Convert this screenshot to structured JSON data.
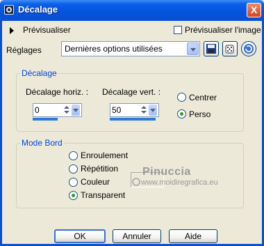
{
  "window": {
    "title": "Décalage",
    "close_glyph": "X"
  },
  "preview": {
    "toggle_label": "Prévisualiser",
    "checkbox_label": "Prévisualiser l'image",
    "checkbox_checked": false
  },
  "settings": {
    "label": "Réglages",
    "preset_value": "Dernières options utilisées"
  },
  "offset_group": {
    "title": "Décalage",
    "horizontal_label": "Décalage horiz. :",
    "horizontal_value": "0",
    "vertical_label": "Décalage vert. :",
    "vertical_value": "50",
    "radio_centered": "Centrer",
    "radio_custom": "Perso",
    "selected": "Perso"
  },
  "edge_group": {
    "title": "Mode Bord",
    "options": [
      "Enroulement",
      "Répétition",
      "Couleur",
      "Transparent"
    ],
    "selected": "Transparent"
  },
  "watermark": {
    "name": "Pinuccia",
    "url": "www.moidiregrafica.eu"
  },
  "buttons": {
    "ok": "OK",
    "cancel": "Annuler",
    "help": "Aide"
  },
  "colors": {
    "title_bar": "#0453dd",
    "accent": "#0046d5",
    "dialog_bg": "#ece9d8"
  }
}
